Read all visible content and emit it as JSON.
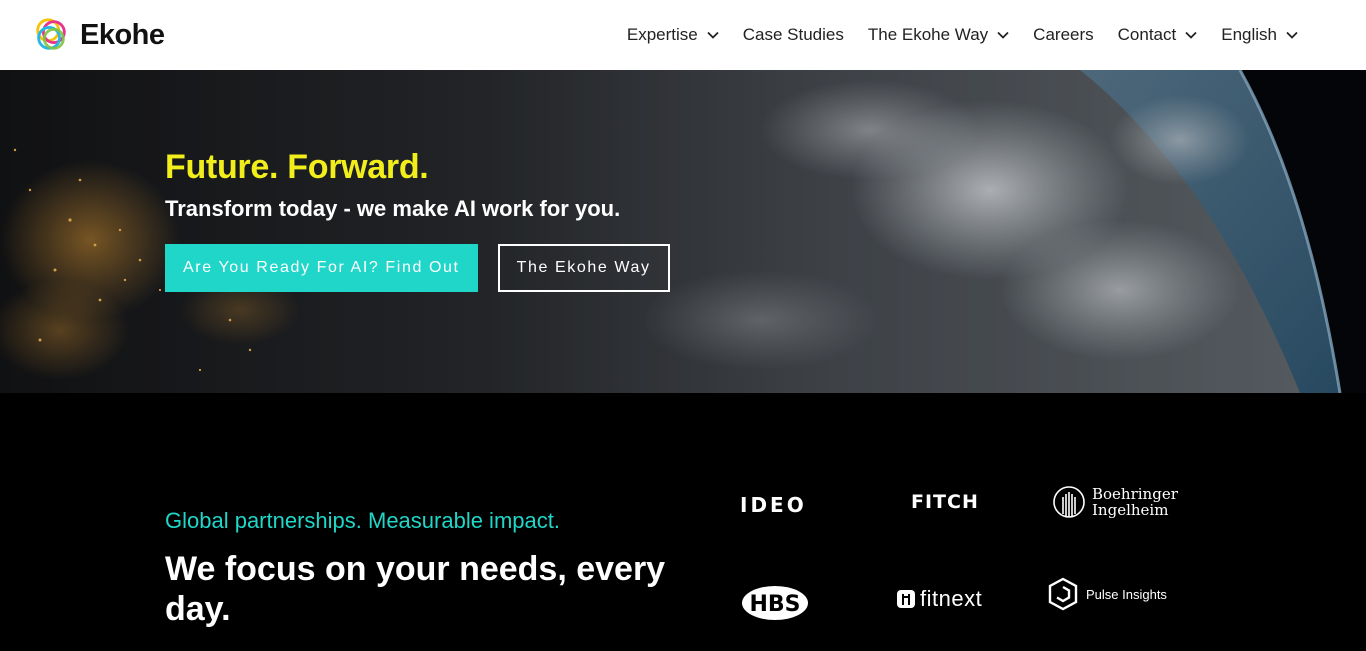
{
  "header": {
    "brand": "Ekohe",
    "nav": [
      {
        "label": "Expertise",
        "has_dropdown": true
      },
      {
        "label": "Case Studies",
        "has_dropdown": false
      },
      {
        "label": "The Ekohe Way",
        "has_dropdown": true
      },
      {
        "label": "Careers",
        "has_dropdown": false
      },
      {
        "label": "Contact",
        "has_dropdown": true
      },
      {
        "label": "English",
        "has_dropdown": true
      }
    ]
  },
  "hero": {
    "title": "Future. Forward.",
    "subtitle": "Transform today - we make AI work for you.",
    "primary_button": "Are You Ready For AI? Find Out",
    "secondary_button": "The Ekohe Way"
  },
  "partners": {
    "eyebrow": "Global partnerships. Measurable impact.",
    "heading": "We focus on your needs, every day.",
    "logos": {
      "ideo": "IDEO",
      "fitch": "FITCH",
      "boehringer_line1": "Boehringer",
      "boehringer_line2": "Ingelheim",
      "hbs": "HBS",
      "fitnext": "fitnext",
      "pulse": "Pulse Insights"
    }
  },
  "colors": {
    "accent_teal": "#1fd6c8",
    "title_yellow": "#f2ee1c",
    "header_bg": "#ffffff",
    "section_bg": "#000000"
  },
  "icons": [
    "ekohe-logo-icon",
    "chevron-down-icon",
    "boehringer-logo-icon",
    "fitnext-logo-icon",
    "pulse-insights-logo-icon"
  ]
}
